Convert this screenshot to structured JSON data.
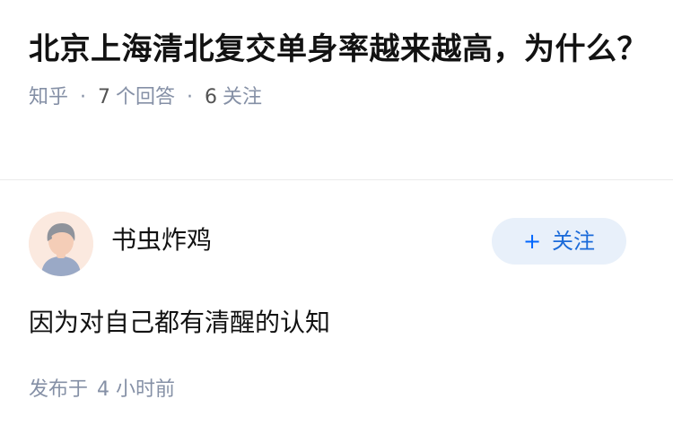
{
  "question": {
    "title": "北京上海清北复交单身率越来越高，为什么？",
    "source": "知乎",
    "answer_count": "7",
    "answer_label": "个回答",
    "follower_count": "6",
    "follower_label": "关注"
  },
  "answer": {
    "author_name": "书虫炸鸡",
    "follow_label": "关注",
    "follow_icon": "plus-icon",
    "content": "因为对自己都有清醒的认知",
    "time_label": "发布于",
    "time_value": "4 小时前"
  },
  "colors": {
    "accent": "#0066ff",
    "follow_bg": "#e8f0fa",
    "meta_text": "#8590a6",
    "avatar_bg": "#fbe9df"
  }
}
